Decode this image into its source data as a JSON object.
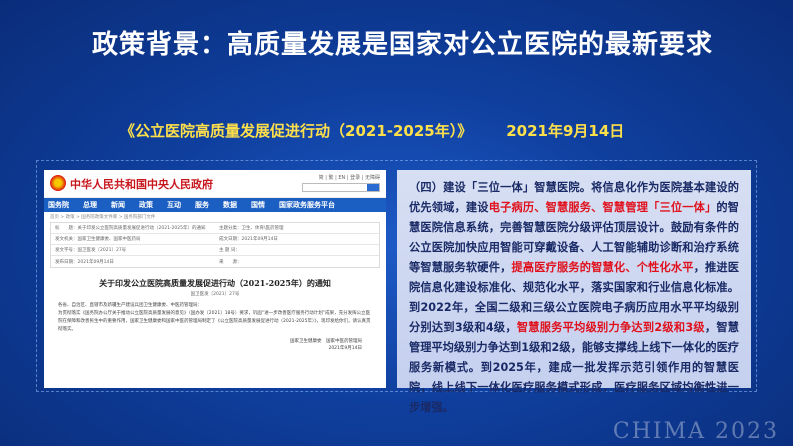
{
  "title": "政策背景：高质量发展是国家对公立医院的最新要求",
  "subtitle": {
    "doc": "《公立医院高质量发展促进行动（2021-2025年）》",
    "date": "2021年9月14日"
  },
  "website": {
    "site_name": "中华人民共和国中央人民政府",
    "top_links": "简 | 繁 | EN | 登录 | 无障碍",
    "nav": [
      "国务院",
      "总理",
      "新闻",
      "政策",
      "互动",
      "服务",
      "数据",
      "国情",
      "国家政务服务平台"
    ],
    "breadcrumb": "首页 > 政策 > 国务院政策文件库 > 国务院部门文件",
    "meta_rows": [
      [
        "标　　题：关于印发公立医院高质量发展促进行动（2021-2025年）的通知",
        "主题分类：卫生、体育\\医药管理"
      ],
      [
        "发文机关：国家卫生健康委、国家中医药局",
        "成文日期：2021年09月14日"
      ],
      [
        "发文字号：国卫医发〔2021〕27号",
        "主 题 词："
      ],
      [
        "发布日期：2021年09月14日",
        "来　　源："
      ]
    ],
    "doc_title": "关于印发公立医院高质量发展促进行动（2021-2025年）的通知",
    "doc_no": "国卫医发〔2021〕27号",
    "body_lines": [
      "各省、自治区、直辖市及新疆生产建设兵团卫生健康委、中医药管理局：",
      "为贯彻落实《国务院办公厅关于推动公立医院高质量发展的意见》（国办发〔2021〕18号）要求，巩固“进一步改善医疗服务行动计划”成果，充分发挥公立医院在保障和改善民生中的重要作用，国家卫生健康委和国家中医药管理局制定了《公立医院高质量发展促进行动（2021-2025年）》，现印发给你们，请认真贯彻落实。"
    ],
    "sign_lines": [
      "国家卫生健康委　国家中医药管理局",
      "2021年9月14日"
    ]
  },
  "text_box": {
    "parts": [
      {
        "text": "（四）建设「三位一体」智慧医院。将信息化作为医院基本建设的优先领域，建设",
        "red": false
      },
      {
        "text": "电子病历、智慧服务、智慧管理「三位一体」",
        "red": true
      },
      {
        "text": "的智慧医院信息系统，完善智慧医院分级评估顶层设计。鼓励有条件的公立医院加快应用智能可穿戴设备、人工智能辅助诊断和治疗系统等智慧服务软硬件，",
        "red": false
      },
      {
        "text": "提高医疗服务的智慧化、个性化水平",
        "red": true
      },
      {
        "text": "，推进医院信息化建设标准化、规范化水平，落实国家和行业信息化标准。到2022年，全国二级和三级公立医院电子病历应用水平平均级别分别达到3级和4级，",
        "red": false
      },
      {
        "text": "智慧服务平均级别力争达到2级和3级",
        "red": true
      },
      {
        "text": "，智慧管理平均级别力争达到1级和2级，能够支撑线上线下一体化的医疗服务新模式。到2025年，建成一批发挥示范引领作用的智慧医院，线上线下一体化医疗服务模式形成，医疗服务区域均衡性进一步增强。",
        "red": false
      }
    ]
  },
  "watermark": "CHIMA 2023"
}
